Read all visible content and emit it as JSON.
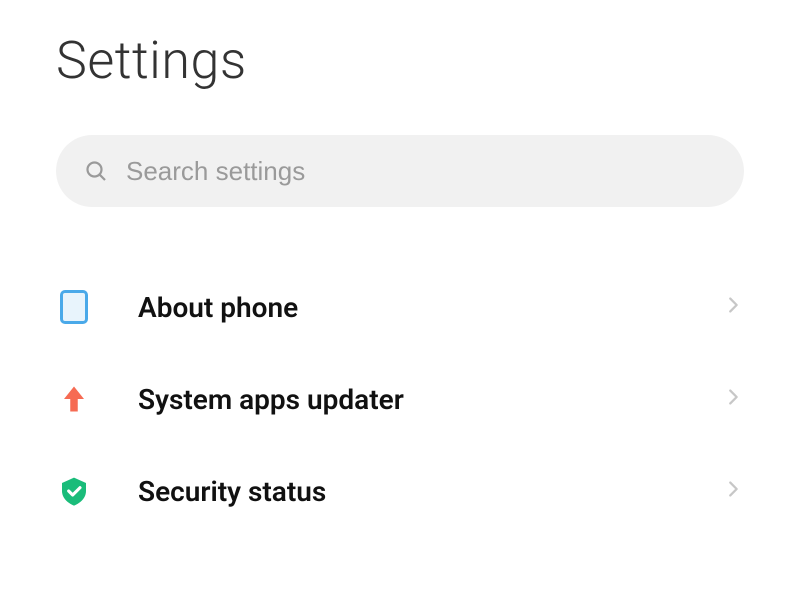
{
  "header": {
    "title": "Settings"
  },
  "search": {
    "placeholder": "Search settings"
  },
  "items": [
    {
      "label": "About phone",
      "icon": "phone-outline-icon"
    },
    {
      "label": "System apps updater",
      "icon": "arrow-up-icon"
    },
    {
      "label": "Security status",
      "icon": "shield-check-icon"
    }
  ],
  "colors": {
    "phone_outline": "#4aa9e9",
    "arrow_up": "#f66b53",
    "shield": "#1abc7a",
    "chevron": "#c7c7c7"
  }
}
